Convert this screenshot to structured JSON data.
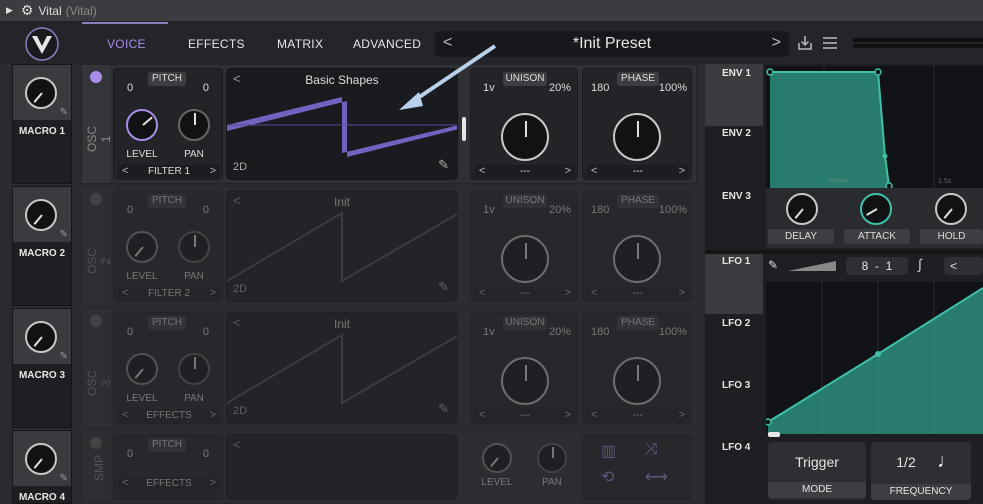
{
  "titlebar": {
    "name": "Vital",
    "sub": "(Vital)"
  },
  "tabs": [
    "VOICE",
    "EFFECTS",
    "MATRIX",
    "ADVANCED"
  ],
  "preset": {
    "name": "*Init Preset",
    "prev": "<",
    "next": ">"
  },
  "macros": [
    "MACRO 1",
    "MACRO 2",
    "MACRO 3",
    "MACRO 4"
  ],
  "osc1": {
    "label": "OSC 1",
    "pitch_label": "PITCH",
    "pitch_left": "0",
    "pitch_right": "0",
    "level_label": "LEVEL",
    "pan_label": "PAN",
    "filter": "FILTER 1",
    "wavetable": "Basic Shapes",
    "mode": "2D",
    "unison_label": "UNISON",
    "unison_voices": "1v",
    "unison_pct": "20%",
    "phase_label": "PHASE",
    "phase_deg": "180",
    "phase_pct": "100%",
    "unison_sel": "---",
    "phase_sel": "---"
  },
  "osc2": {
    "label": "OSC 2",
    "pitch_label": "PITCH",
    "pitch_left": "0",
    "pitch_right": "0",
    "level_label": "LEVEL",
    "pan_label": "PAN",
    "filter": "FILTER 2",
    "wavetable": "Init",
    "mode": "2D",
    "unison_label": "UNISON",
    "unison_voices": "1v",
    "unison_pct": "20%",
    "phase_label": "PHASE",
    "phase_deg": "180",
    "phase_pct": "100%",
    "unison_sel": "---",
    "phase_sel": "---"
  },
  "osc3": {
    "label": "OSC 3",
    "pitch_label": "PITCH",
    "pitch_left": "0",
    "pitch_right": "0",
    "level_label": "LEVEL",
    "pan_label": "PAN",
    "filter": "EFFECTS",
    "wavetable": "Init",
    "mode": "2D",
    "unison_label": "UNISON",
    "unison_voices": "1v",
    "unison_pct": "20%",
    "phase_label": "PHASE",
    "phase_deg": "180",
    "phase_pct": "100%",
    "unison_sel": "---",
    "phase_sel": "---"
  },
  "smp": {
    "label": "SMP",
    "pitch_label": "PITCH",
    "pitch_left": "0",
    "pitch_right": "0",
    "filter": "EFFECTS",
    "level_label": "LEVEL",
    "pan_label": "PAN"
  },
  "env": {
    "tabs": [
      "ENV 1",
      "ENV 2",
      "ENV 3"
    ],
    "knobs": [
      "DELAY",
      "ATTACK",
      "HOLD"
    ],
    "marks": [
      "350ms",
      "1.5s"
    ]
  },
  "lfo": {
    "tabs": [
      "LFO 1",
      "LFO 2",
      "LFO 3",
      "LFO 4"
    ],
    "rate_left": "8",
    "rate_sep": "-",
    "rate_right": "1",
    "mode_value": "Trigger",
    "mode_label": "MODE",
    "freq_value": "1/2",
    "freq_label": "FREQUENCY"
  },
  "colors": {
    "accent": "#a98ee8",
    "teal": "#3fc0a8",
    "wave": "#7c6ad0"
  }
}
